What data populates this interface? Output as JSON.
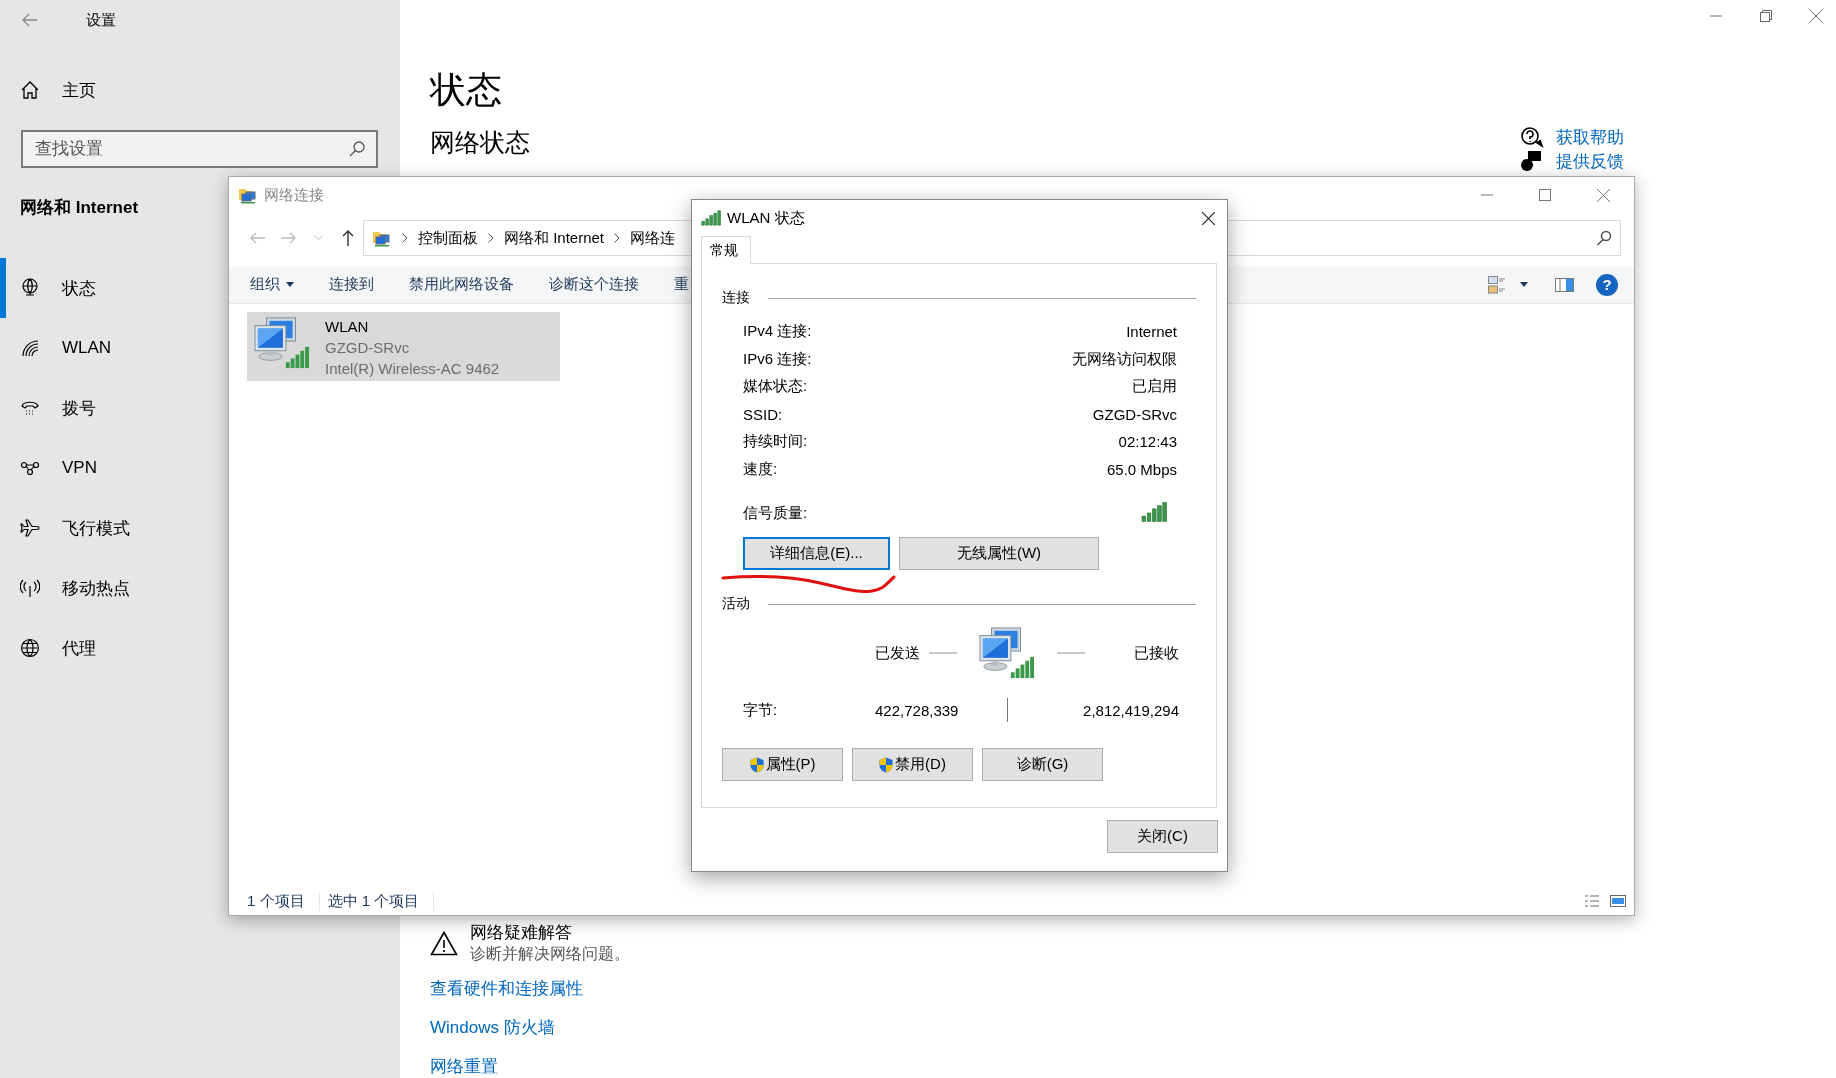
{
  "settings": {
    "title": "设置",
    "home": "主页",
    "search": {
      "placeholder": "查找设置"
    },
    "section": "网络和 Internet",
    "nav": [
      {
        "label": "状态",
        "selected": true
      },
      {
        "label": "WLAN",
        "selected": false
      },
      {
        "label": "拨号",
        "selected": false
      },
      {
        "label": "VPN",
        "selected": false
      },
      {
        "label": "飞行模式",
        "selected": false
      },
      {
        "label": "移动热点",
        "selected": false
      },
      {
        "label": "代理",
        "selected": false
      }
    ],
    "page_title": "状态",
    "page_subtitle": "网络状态",
    "help_links": [
      "获取帮助",
      "提供反馈"
    ],
    "troubleshooter": {
      "title": "网络疑难解答",
      "description": "诊断并解决网络问题。"
    },
    "links": [
      "查看硬件和连接属性",
      "Windows 防火墙",
      "网络重置"
    ]
  },
  "explorer": {
    "title": "网络连接",
    "breadcrumb": [
      "控制面板",
      "网络和 Internet",
      "网络连"
    ],
    "toolbar": [
      {
        "label": "组织",
        "dropdown": true
      },
      {
        "label": "连接到",
        "dropdown": false
      },
      {
        "label": "禁用此网络设备",
        "dropdown": false
      },
      {
        "label": "诊断这个连接",
        "dropdown": false
      },
      {
        "label": "重",
        "dropdown": false
      }
    ],
    "items": [
      {
        "name": "WLAN",
        "network": "GZGD-SRvc",
        "adapter": "Intel(R) Wireless-AC 9462",
        "selected": true
      }
    ],
    "help_button": "?",
    "status_bar": [
      "1 个项目",
      "选中 1 个项目"
    ]
  },
  "dialog": {
    "title": "WLAN 状态",
    "tabs": [
      {
        "label": "常规",
        "selected": true
      }
    ],
    "connection": {
      "heading": "连接",
      "rows": [
        {
          "label": "IPv4 连接:",
          "value": "Internet"
        },
        {
          "label": "IPv6 连接:",
          "value": "无网络访问权限"
        },
        {
          "label": "媒体状态:",
          "value": "已启用"
        },
        {
          "label": "SSID:",
          "value": "GZGD-SRvc"
        },
        {
          "label": "持续时间:",
          "value": "02:12:43"
        },
        {
          "label": "速度:",
          "value": "65.0 Mbps"
        }
      ],
      "signal_label": "信号质量:"
    },
    "buttons": [
      {
        "label": "详细信息(E)...",
        "focused": true
      },
      {
        "label": "无线属性(W)",
        "focused": false
      }
    ],
    "activity": {
      "heading": "活动",
      "sent_label": "已发送",
      "received_label": "已接收",
      "bytes_label": "字节:",
      "bytes_sent": "422,728,339",
      "bytes_received": "2,812,419,294"
    },
    "action_buttons": [
      {
        "label": "属性(P)",
        "shield": true
      },
      {
        "label": "禁用(D)",
        "shield": true
      },
      {
        "label": "诊断(G)",
        "shield": false
      }
    ],
    "close_button": "关闭(C)"
  }
}
